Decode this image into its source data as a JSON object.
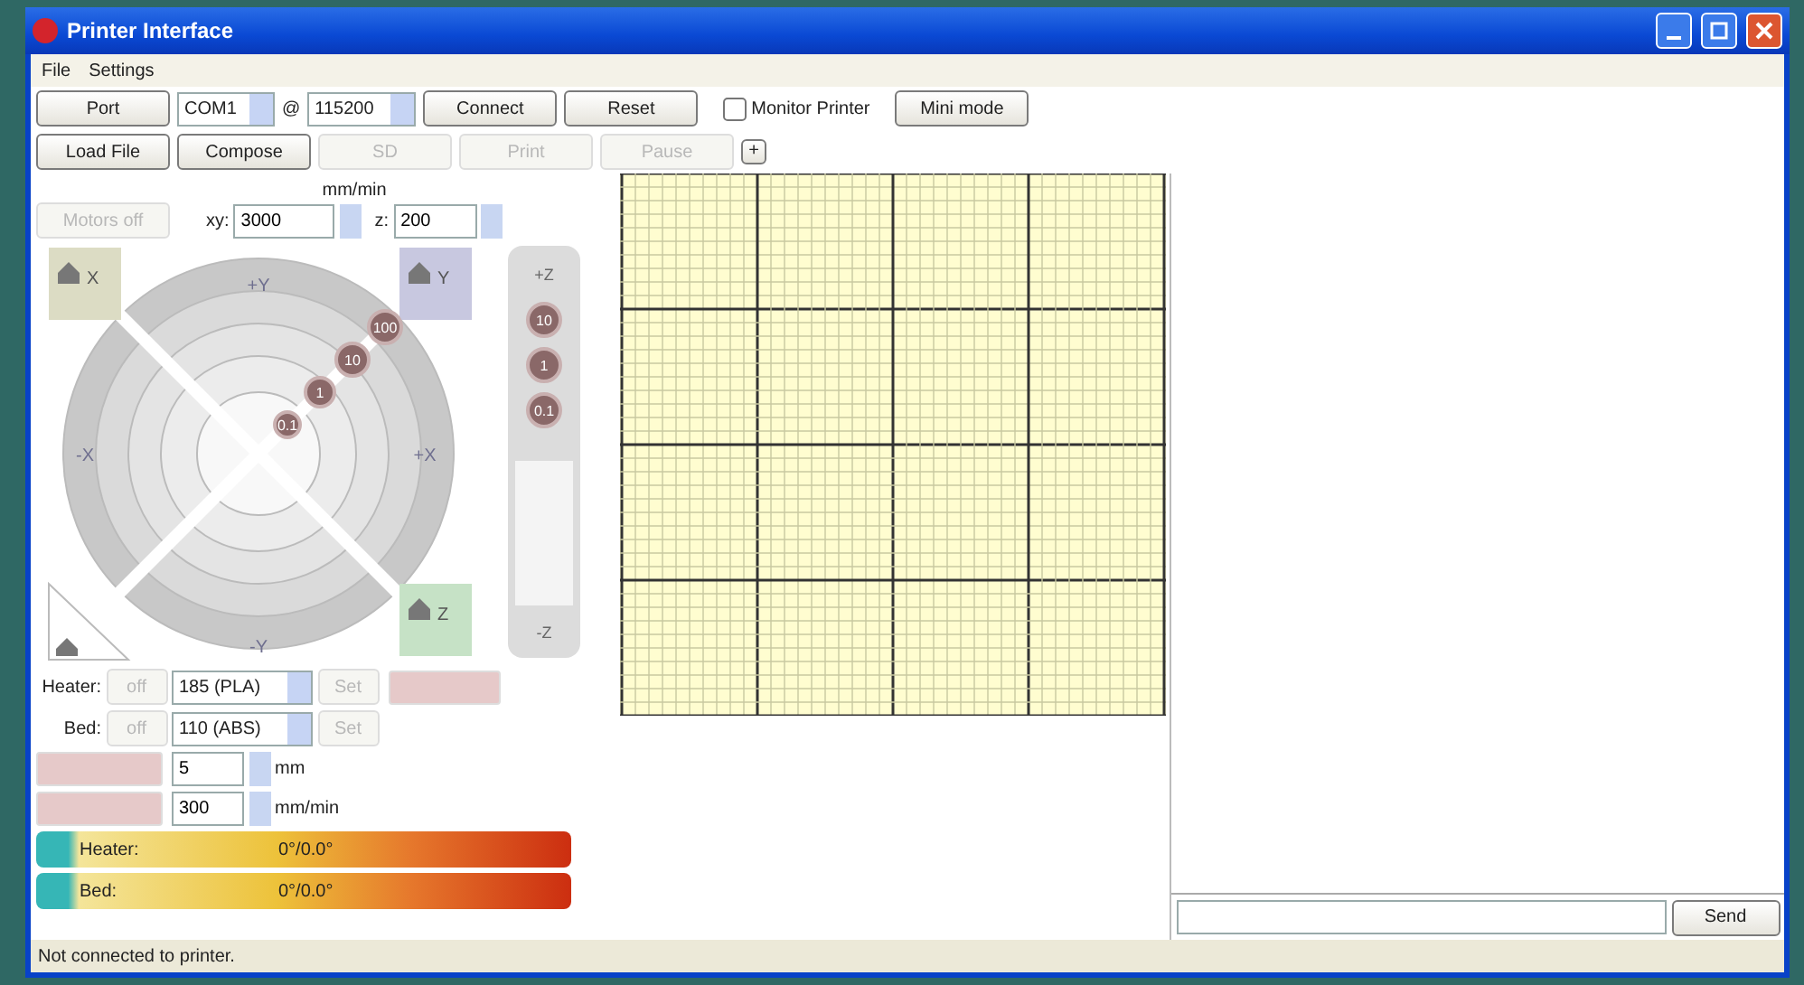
{
  "window": {
    "title": "Printer Interface"
  },
  "menu": [
    {
      "label": "File"
    },
    {
      "label": "Settings"
    }
  ],
  "connection": {
    "port_button": "Port",
    "port": "COM1",
    "at": "@",
    "baud": "115200",
    "connect": "Connect",
    "reset": "Reset",
    "monitor": {
      "label": "Monitor Printer",
      "checked": false
    },
    "mini_mode": "Mini mode"
  },
  "file_buttons": [
    {
      "label": "Load File",
      "disabled": false
    },
    {
      "label": "Compose",
      "disabled": false
    },
    {
      "label": "SD",
      "disabled": true
    },
    {
      "label": "Print",
      "disabled": true
    },
    {
      "label": "Pause",
      "disabled": true
    },
    {
      "label": "+",
      "disabled": false
    }
  ],
  "motion": {
    "motors_off": "Motors off",
    "feed_label": "mm/min",
    "xy_label": "xy:",
    "xy_value": "3000",
    "z_label": "z:",
    "z_value": "200"
  },
  "jog": {
    "xy_steps": [
      "100",
      "10",
      "1",
      "0.1"
    ],
    "z_steps": [
      "10",
      "1",
      "0.1"
    ],
    "home": [
      "X",
      "Y",
      "Z"
    ],
    "directions": [
      "+Y",
      "-X",
      "+X",
      "-Y"
    ],
    "z_directions": [
      "+Z",
      "-Z"
    ]
  },
  "temperatures": [
    {
      "label": "Heater:",
      "off": "off",
      "preset": "185 (PLA)",
      "set": "Set"
    },
    {
      "label": "Bed:",
      "off": "off",
      "preset": "110 (ABS)",
      "set": "Set"
    }
  ],
  "extrusion": [
    {
      "value": "5",
      "unit": "mm"
    },
    {
      "value": "300",
      "unit": "mm/min"
    }
  ],
  "gauges": [
    {
      "label": "Heater:",
      "reading": "0°/0.0°"
    },
    {
      "label": "Bed:",
      "reading": "0°/0.0°"
    }
  ],
  "console": {
    "send": "Send"
  },
  "status_bar": "Not connected to printer."
}
